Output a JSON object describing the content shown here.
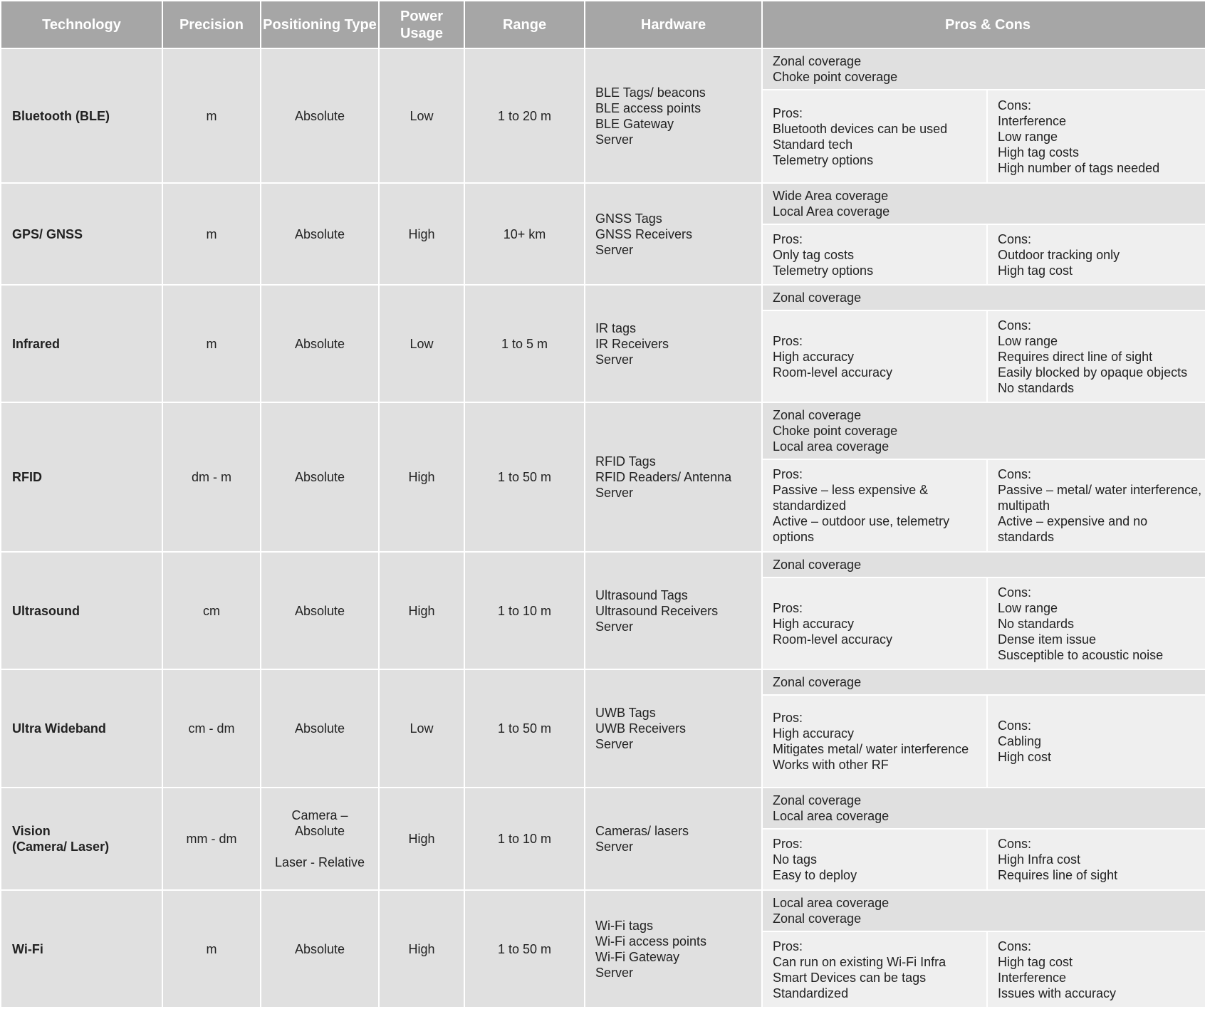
{
  "headers": [
    "Technology",
    "Precision",
    "Positioning Type",
    "Power Usage",
    "Range",
    "Hardware",
    "Pros & Cons"
  ],
  "rows": [
    {
      "technology": "Bluetooth (BLE)",
      "precision": "m",
      "positioning": [
        "Absolute"
      ],
      "power": "Low",
      "range": "1 to 20 m",
      "hardware": [
        "BLE Tags/ beacons",
        "BLE access points",
        "BLE Gateway",
        "Server"
      ],
      "coverage": [
        "Zonal coverage",
        "Choke point coverage"
      ],
      "pros": [
        "Pros:",
        "Bluetooth devices can be used",
        "Standard tech",
        "Telemetry options"
      ],
      "cons": [
        "Cons:",
        "Interference",
        "Low range",
        "High tag costs",
        "High number of tags needed"
      ]
    },
    {
      "technology": "GPS/ GNSS",
      "precision": "m",
      "positioning": [
        "Absolute"
      ],
      "power": "High",
      "range": "10+ km",
      "hardware": [
        "GNSS Tags",
        "GNSS Receivers",
        "Server"
      ],
      "coverage": [
        "Wide Area coverage",
        "Local Area coverage"
      ],
      "pros": [
        "Pros:",
        "Only tag costs",
        "Telemetry options"
      ],
      "cons": [
        "Cons:",
        "Outdoor tracking only",
        "High tag cost"
      ]
    },
    {
      "technology": "Infrared",
      "precision": "m",
      "positioning": [
        "Absolute"
      ],
      "power": "Low",
      "range": "1 to 5 m",
      "hardware": [
        "IR tags",
        "IR Receivers",
        "Server"
      ],
      "coverage": [
        "Zonal coverage"
      ],
      "pros": [
        "Pros:",
        "High accuracy",
        "Room-level accuracy"
      ],
      "cons": [
        "Cons:",
        "Low range",
        "Requires direct line of sight",
        "Easily blocked by opaque objects",
        "No standards"
      ]
    },
    {
      "technology": "RFID",
      "precision": "dm - m",
      "positioning": [
        "Absolute"
      ],
      "power": "High",
      "range": "1 to 50 m",
      "hardware": [
        "RFID Tags",
        "RFID Readers/ Antenna",
        "Server"
      ],
      "coverage": [
        "Zonal coverage",
        "Choke point coverage",
        "Local area coverage"
      ],
      "pros": [
        "Pros:",
        "Passive – less expensive & standardized",
        "Active – outdoor use, telemetry options"
      ],
      "cons": [
        "Cons:",
        "Passive – metal/ water interference, multipath",
        "Active – expensive and no standards"
      ]
    },
    {
      "technology": "Ultrasound",
      "precision": "cm",
      "positioning": [
        "Absolute"
      ],
      "power": "High",
      "range": "1 to 10 m",
      "hardware": [
        "Ultrasound Tags",
        "Ultrasound Receivers",
        "Server"
      ],
      "coverage": [
        "Zonal coverage"
      ],
      "pros": [
        "Pros:",
        "High accuracy",
        "Room-level accuracy"
      ],
      "cons": [
        "Cons:",
        "Low range",
        "No standards",
        "Dense item issue",
        "Susceptible to acoustic noise"
      ]
    },
    {
      "technology": "Ultra Wideband",
      "precision": "cm - dm",
      "positioning": [
        "Absolute"
      ],
      "power": "Low",
      "range": "1 to 50 m",
      "hardware": [
        "UWB Tags",
        "UWB Receivers",
        "Server"
      ],
      "coverage": [
        "Zonal coverage"
      ],
      "pros": [
        "Pros:",
        "High accuracy",
        "Mitigates metal/ water interference",
        "Works with other RF"
      ],
      "cons": [
        "Cons:",
        "Cabling",
        "High cost"
      ]
    },
    {
      "technology": "Vision\n(Camera/ Laser)",
      "precision": "mm - dm",
      "positioning": [
        "Camera –",
        "Absolute",
        "",
        "Laser - Relative"
      ],
      "power": "High",
      "range": "1 to 10 m",
      "hardware": [
        "Cameras/ lasers",
        "Server"
      ],
      "coverage": [
        "Zonal coverage",
        "Local area coverage"
      ],
      "pros": [
        "Pros:",
        "No tags",
        "Easy to deploy"
      ],
      "cons": [
        "Cons:",
        "High Infra cost",
        "Requires line of sight"
      ]
    },
    {
      "technology": "Wi-Fi",
      "precision": "m",
      "positioning": [
        "Absolute"
      ],
      "power": "High",
      "range": "1 to 50 m",
      "hardware": [
        "Wi-Fi tags",
        "Wi-Fi access points",
        "Wi-Fi Gateway",
        "Server"
      ],
      "coverage": [
        "Local area coverage",
        "Zonal coverage"
      ],
      "pros": [
        "Pros:",
        "Can run on existing Wi-Fi Infra",
        "Smart Devices can be tags",
        "Standardized"
      ],
      "cons": [
        "Cons:",
        "High tag cost",
        "Interference",
        "Issues with accuracy"
      ]
    }
  ]
}
